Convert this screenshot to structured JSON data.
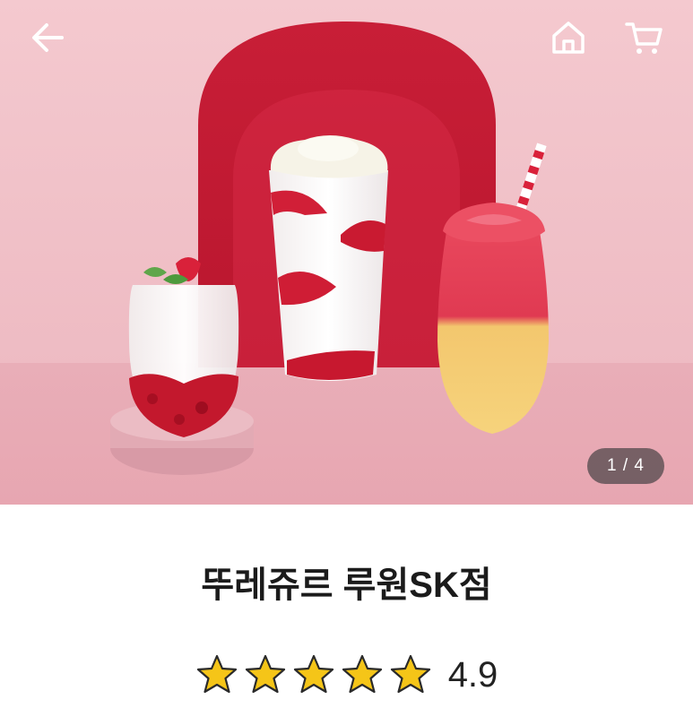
{
  "gallery": {
    "current": 1,
    "total": 4,
    "counter_text": "1 / 4"
  },
  "icons": {
    "back": "arrow-left-icon",
    "home": "home-icon",
    "cart": "cart-icon",
    "star": "star-icon"
  },
  "store": {
    "name": "뚜레쥬르 루원SK점",
    "rating_text": "4.9",
    "rating_value": 4.9,
    "rating_max": 5
  },
  "colors": {
    "star_fill": "#f5c518",
    "header_icon": "#ffffff",
    "counter_bg": "#4b4446"
  }
}
